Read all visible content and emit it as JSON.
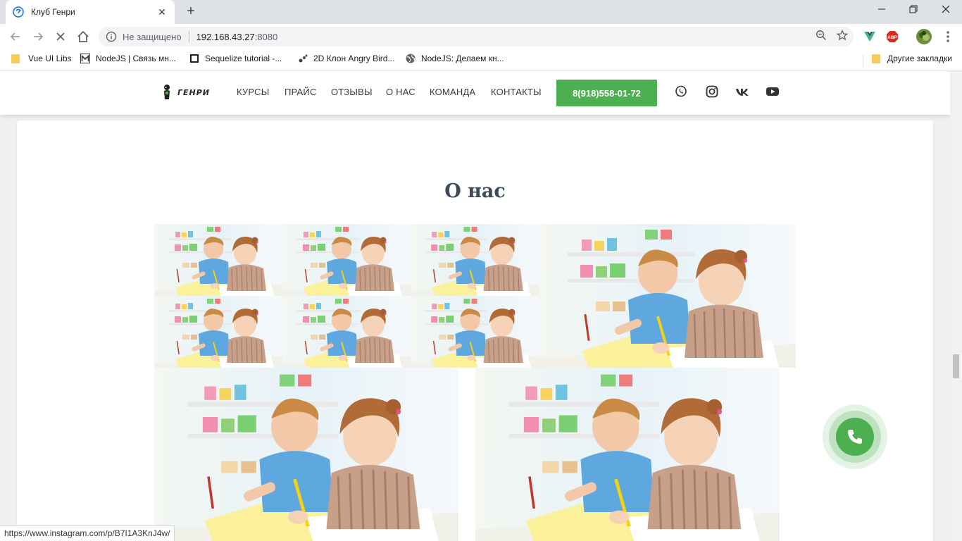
{
  "browser": {
    "tab_title": "Клуб Генри",
    "new_tab_symbol": "+",
    "security_label": "Не защищено",
    "url_host": "192.168.43.27",
    "url_port": ":8080",
    "window_controls": [
      "minimize-icon",
      "restore-icon",
      "close-icon"
    ],
    "bookmarks": [
      {
        "label": "Vue UI Libs",
        "icon": "folder-icon"
      },
      {
        "label": "NodeJS | Связь мн...",
        "icon": "m-icon"
      },
      {
        "label": "Sequelize tutorial -...",
        "icon": "square-icon"
      },
      {
        "label": "2D Клон Angry Bird...",
        "icon": "bird-icon"
      },
      {
        "label": "NodeJS: Делаем кн...",
        "icon": "globe-icon"
      }
    ],
    "other_bookmarks": "Другие закладки",
    "abp_label": "ABP"
  },
  "site": {
    "logo_text": "ГЕНРИ",
    "nav": [
      "КУРСЫ",
      "ПРАЙС",
      "ОТЗЫВЫ",
      "О НАС",
      "КОМАНДА",
      "КОНТАКТЫ"
    ],
    "phone": "8(918)558-01-72",
    "social": [
      "whatsapp-icon",
      "instagram-icon",
      "vk-icon",
      "youtube-icon"
    ],
    "section_title": "О нас",
    "accent": "#4caf50"
  },
  "status_bar_url": "https://www.instagram.com/p/B7I1A3KnJ4w/"
}
